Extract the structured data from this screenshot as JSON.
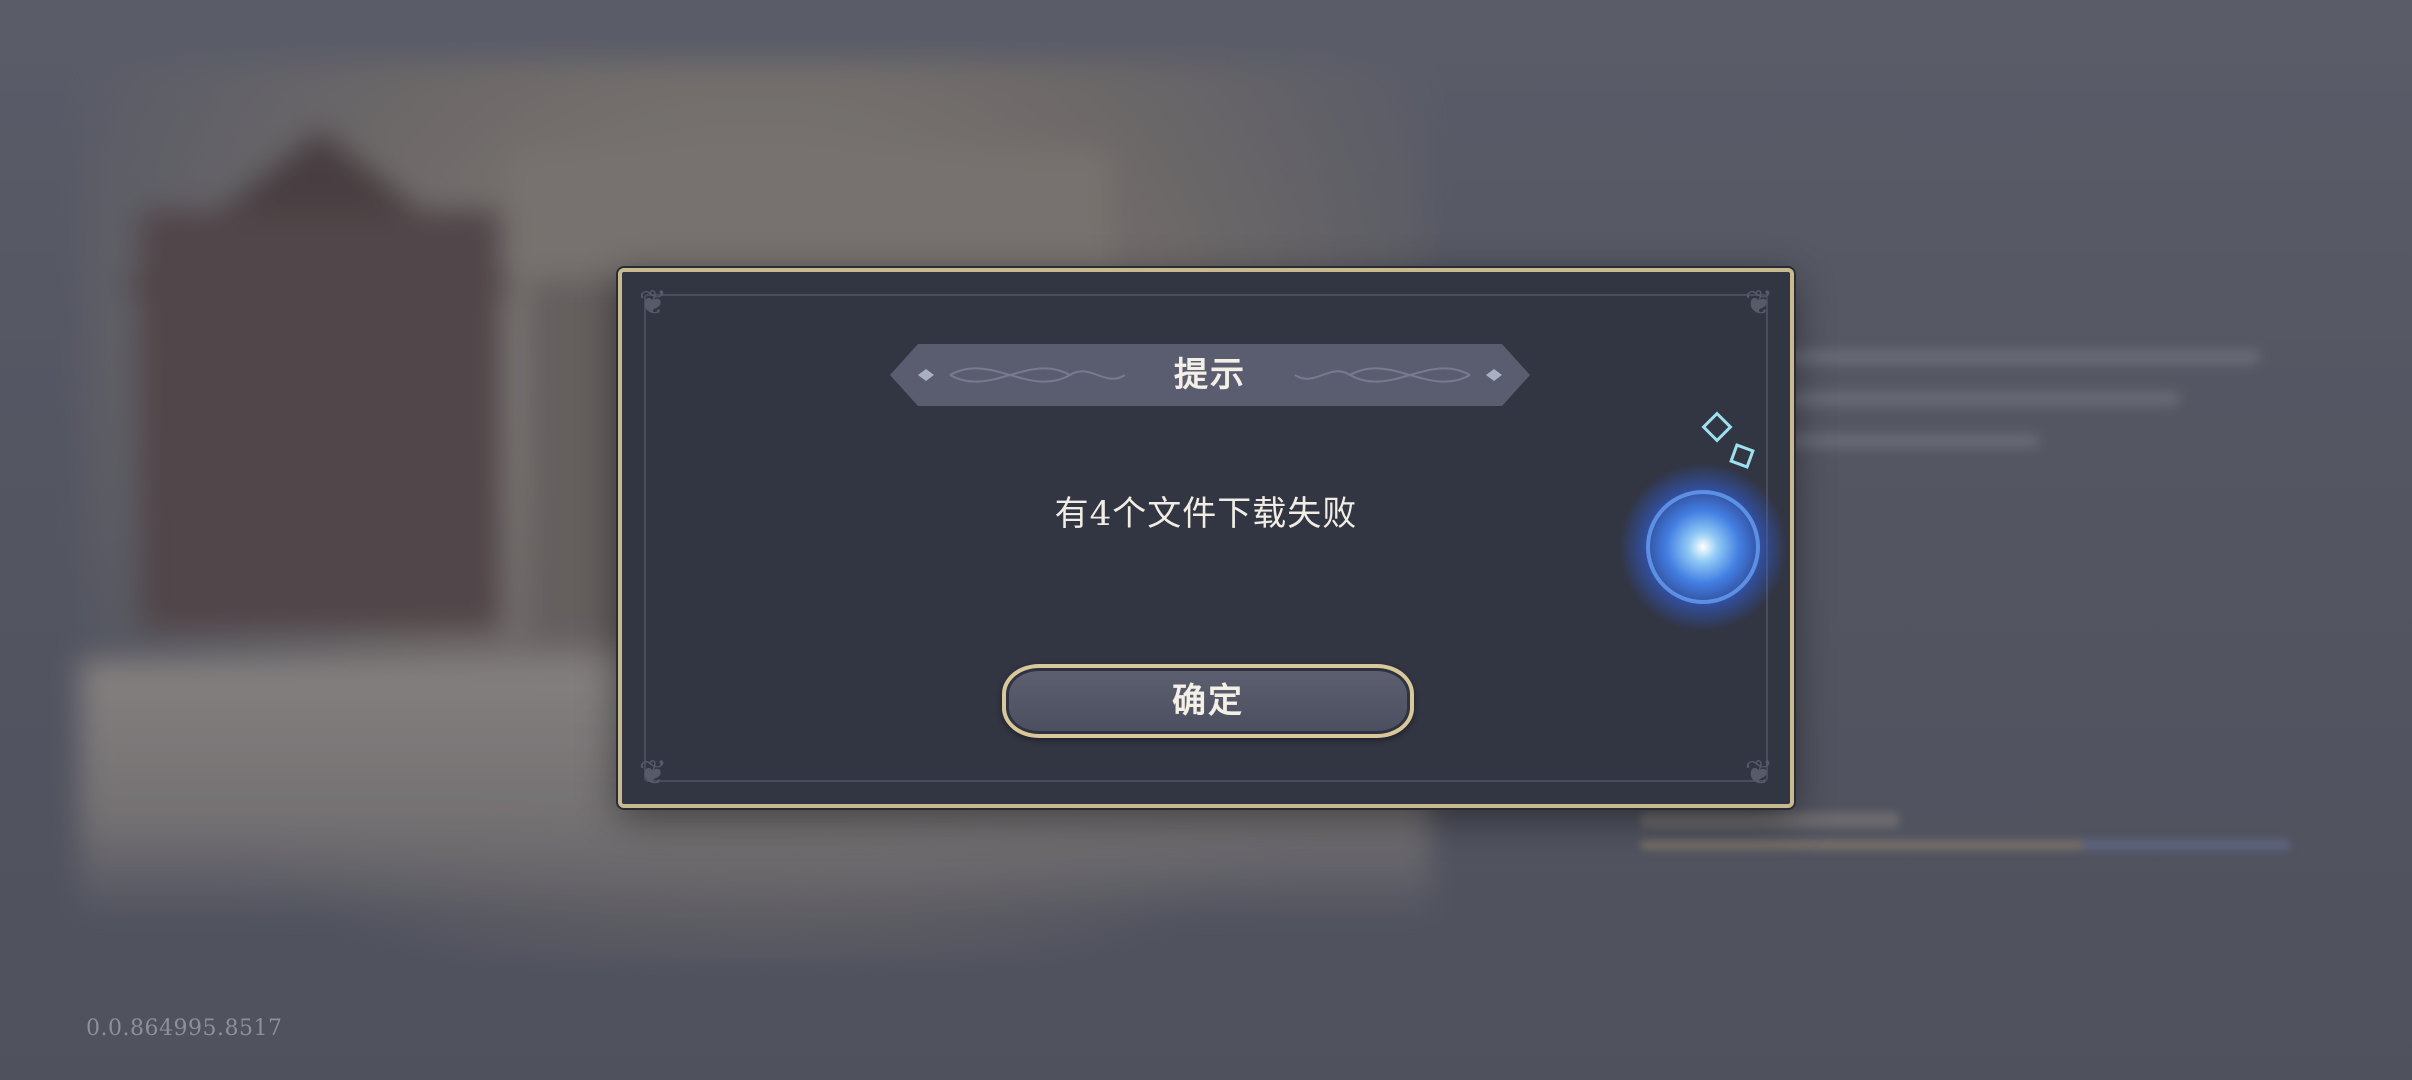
{
  "dialog": {
    "title": "提示",
    "message": "有4个文件下载失败",
    "confirm_label": "确定"
  },
  "footer": {
    "version": "0.0.864995.8517"
  },
  "icons": {
    "corner": "ornament-corner-icon",
    "orb": "glowing-orb-icon"
  },
  "colors": {
    "dialog_background": "#323542",
    "dialog_border": "#c8b98e",
    "text": "#f1ede4",
    "orb": "#4a8cff"
  }
}
